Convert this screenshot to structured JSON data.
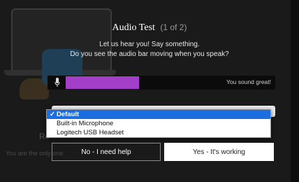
{
  "modal": {
    "title": "Audio Test",
    "step": "(1 of 2)",
    "message_line1": "Let us hear you! Say something.",
    "message_line2": "Do you see the audio bar moving when you speak?",
    "meter": {
      "level": 0.35,
      "status": "You sound great!",
      "fill_color": "#a23ec8",
      "icon": "microphone-icon"
    },
    "device_select": {
      "options": [
        {
          "label": "Default",
          "selected": true,
          "check": "✓"
        },
        {
          "label": "Built-in Microphone",
          "selected": false
        },
        {
          "label": "Logitech USB Headset",
          "selected": false
        }
      ]
    },
    "buttons": {
      "no_label": "No - I need help",
      "yes_label": "Yes - It's working"
    }
  },
  "background": {
    "partial_text_re": "Re",
    "partial_text_line": "You are the only one"
  },
  "colors": {
    "overlay": "#1a1a1a",
    "selected_option": "#1c6de0"
  }
}
